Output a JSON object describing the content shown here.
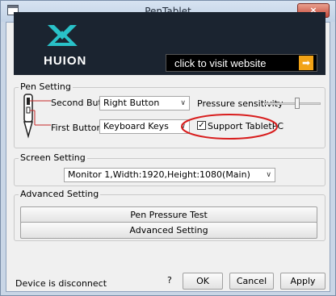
{
  "window": {
    "title": "PenTablet",
    "close_label": "×"
  },
  "banner": {
    "brand": "HUION",
    "visit_text": "click to visit website",
    "arrow": "➡"
  },
  "pen_setting": {
    "label": "Pen Setting",
    "second_button_label": "Second Button",
    "second_button_value": "Right Button",
    "first_button_label": "First Button",
    "first_button_value": "Keyboard Keys",
    "pressure_label": "Pressure sensitivity",
    "support_label": "Support TabletPC",
    "support_checked": true
  },
  "screen_setting": {
    "label": "Screen Setting",
    "monitor_value": "Monitor 1,Width:1920,Height:1080(Main)"
  },
  "advanced": {
    "label": "Advanced Setting",
    "pressure_test_button": "Pen Pressure Test",
    "advanced_button": "Advanced Setting"
  },
  "footer": {
    "status": "Device is disconnect",
    "help": "?",
    "ok": "OK",
    "cancel": "Cancel",
    "apply": "Apply"
  },
  "colors": {
    "accent_arrow": "#f2a316",
    "annotation": "#d81e1e"
  }
}
